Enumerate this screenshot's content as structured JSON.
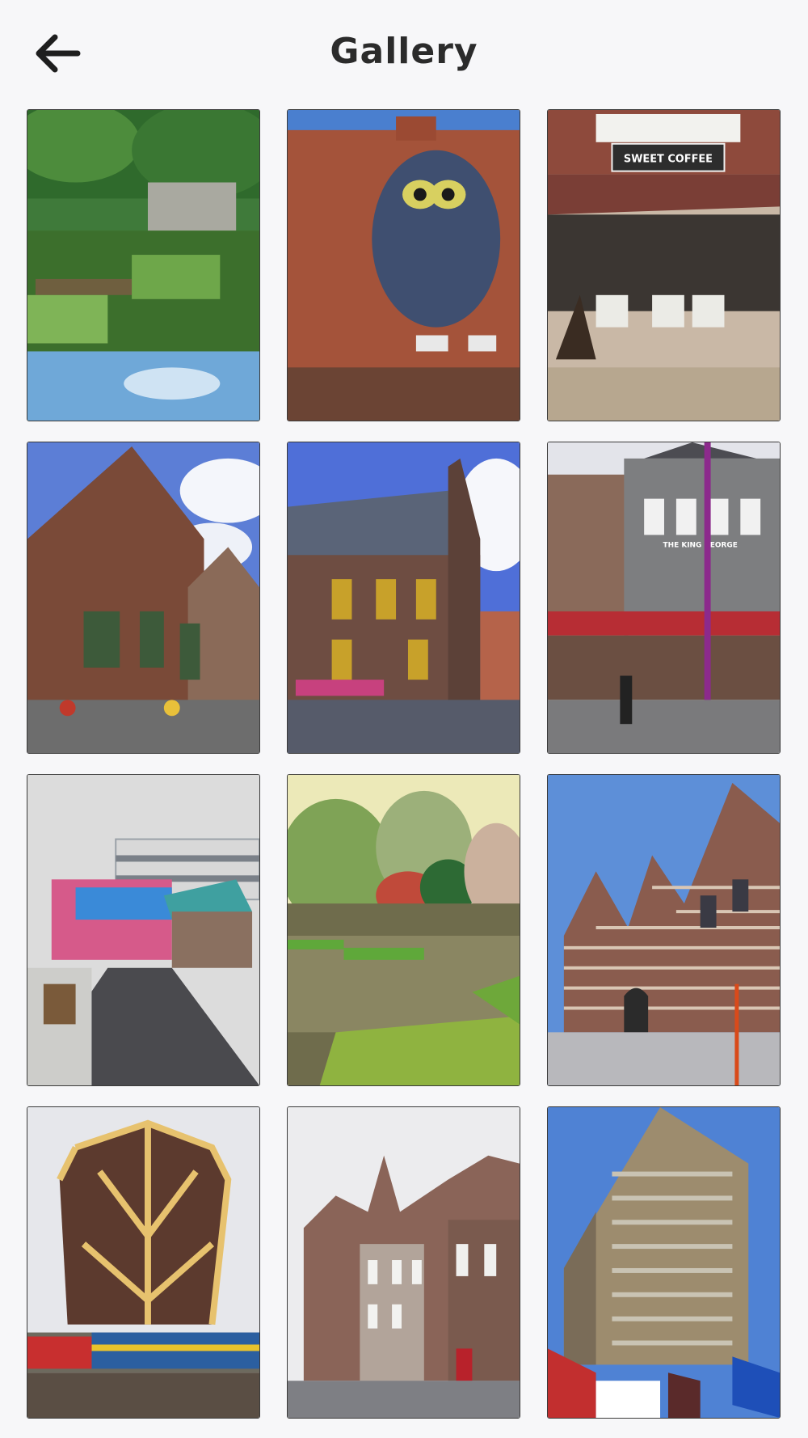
{
  "header": {
    "title": "Gallery",
    "back_icon": "arrow-left-icon"
  },
  "gallery": {
    "photos": [
      {
        "subject": "pond-garden",
        "sign": ""
      },
      {
        "subject": "owl-mural",
        "sign": ""
      },
      {
        "subject": "cafe-terrace",
        "sign": "SWEET COFFEE"
      },
      {
        "subject": "brick-gabled-house",
        "sign": ""
      },
      {
        "subject": "town-hall-square",
        "sign": ""
      },
      {
        "subject": "pub-square",
        "sign": "THE KING GEORGE"
      },
      {
        "subject": "fairground-street",
        "sign": ""
      },
      {
        "subject": "park-pond",
        "sign": ""
      },
      {
        "subject": "striped-brick-building",
        "sign": ""
      },
      {
        "subject": "lattice-tower-train",
        "sign": ""
      },
      {
        "subject": "old-stone-houses",
        "sign": ""
      },
      {
        "subject": "tall-tower-flags",
        "sign": ""
      }
    ]
  }
}
